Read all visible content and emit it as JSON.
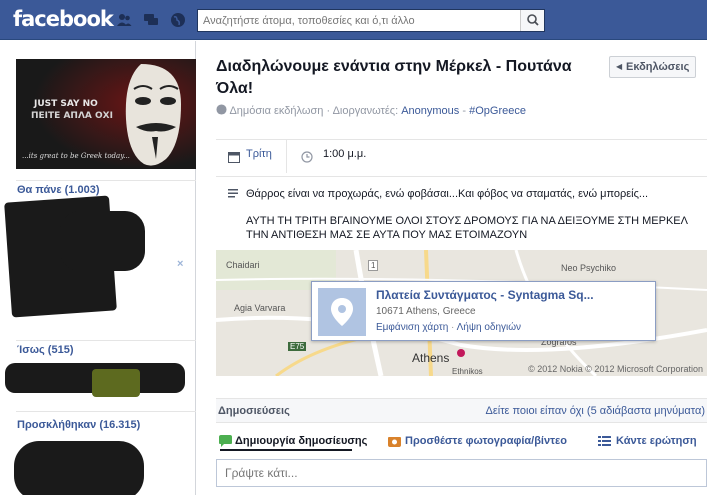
{
  "topbar": {
    "logo": "facebook",
    "search_placeholder": "Αναζητήστε άτομα, τοποθεσίες και ό,τι άλλο"
  },
  "cover": {
    "line1": "JUST SAY NO",
    "line2": "ΠΕΙΤΕ ΑΠΛΑ ΟΧΙ",
    "line3": "...its great to be Greek today..."
  },
  "sidebar": {
    "going": "Θα πάνε (1.003)",
    "maybe": "Ίσως (515)",
    "invited": "Προσκλήθηκαν (16.315)",
    "close_symbol": "×"
  },
  "event": {
    "title": "Διαδηλώνουμε ενάντια στην Μέρκελ - Πουτάνα Όλα!",
    "events_button": "Εκδηλώσεις",
    "visibility": "Δημόσια εκδήλωση",
    "dot": "·",
    "hosts_label": "Διοργανωτές:",
    "host1": "Anonymous",
    "dash": "-",
    "host2": "#OpGreece",
    "day": "Τρίτη",
    "time": "1:00 μ.μ.",
    "desc1": "Θάρρος είναι να προχωράς, ενώ φοβάσαι...Και φόβος να σταματάς, ενώ μπορείς...",
    "desc2": "ΑΥΤΗ ΤΗ ΤΡΙΤΗ ΒΓΑΙΝΟΥΜΕ ΟΛΟΙ ΣΤΟΥΣ ΔΡΟΜΟΥΣ ΓΙΑ ΝΑ ΔΕΙΞΟΥΜΕ ΣΤΗ ΜΕΡΚΕΛ ΤΗΝ ΑΝΤΙΘΕΣΗ ΜΑΣ ΣΕ ΑΥΤΑ ΠΟΥ ΜΑΣ ΕΤΟΙΜΑΖΟΥΝ"
  },
  "map": {
    "place_name": "Πλατεία Συντάγματος - Syntagma Sq...",
    "address": "10671 Athens, Greece",
    "show_map": "Εμφάνιση χάρτη",
    "directions": "Λήψη οδηγιών",
    "copyright": "© 2012 Nokia © 2012 Microsoft Corporation",
    "labels": {
      "chaidari": "Chaidari",
      "neo_psychiko": "Neo Psychiko",
      "agia_varvara": "Agia Varvara",
      "athens": "Athens",
      "zografos": "Zografos",
      "ethnikos": "Ethnikos",
      "route1": "1",
      "route5": "E75"
    }
  },
  "posts": {
    "title": "Δημοσιεύσεις",
    "declined": "Δείτε ποιοι είπαν όχι (5 αδιάβαστα μηνύματα)",
    "tab_post": "Δημιουργία δημοσίευσης",
    "tab_photo": "Προσθέστε φωτογραφία/βίντεο",
    "tab_question": "Κάντε ερώτηση",
    "write_placeholder": "Γράψτε κάτι..."
  },
  "colors": {
    "brand": "#3b5998",
    "link": "#3b5998",
    "muted": "#9197a3"
  }
}
